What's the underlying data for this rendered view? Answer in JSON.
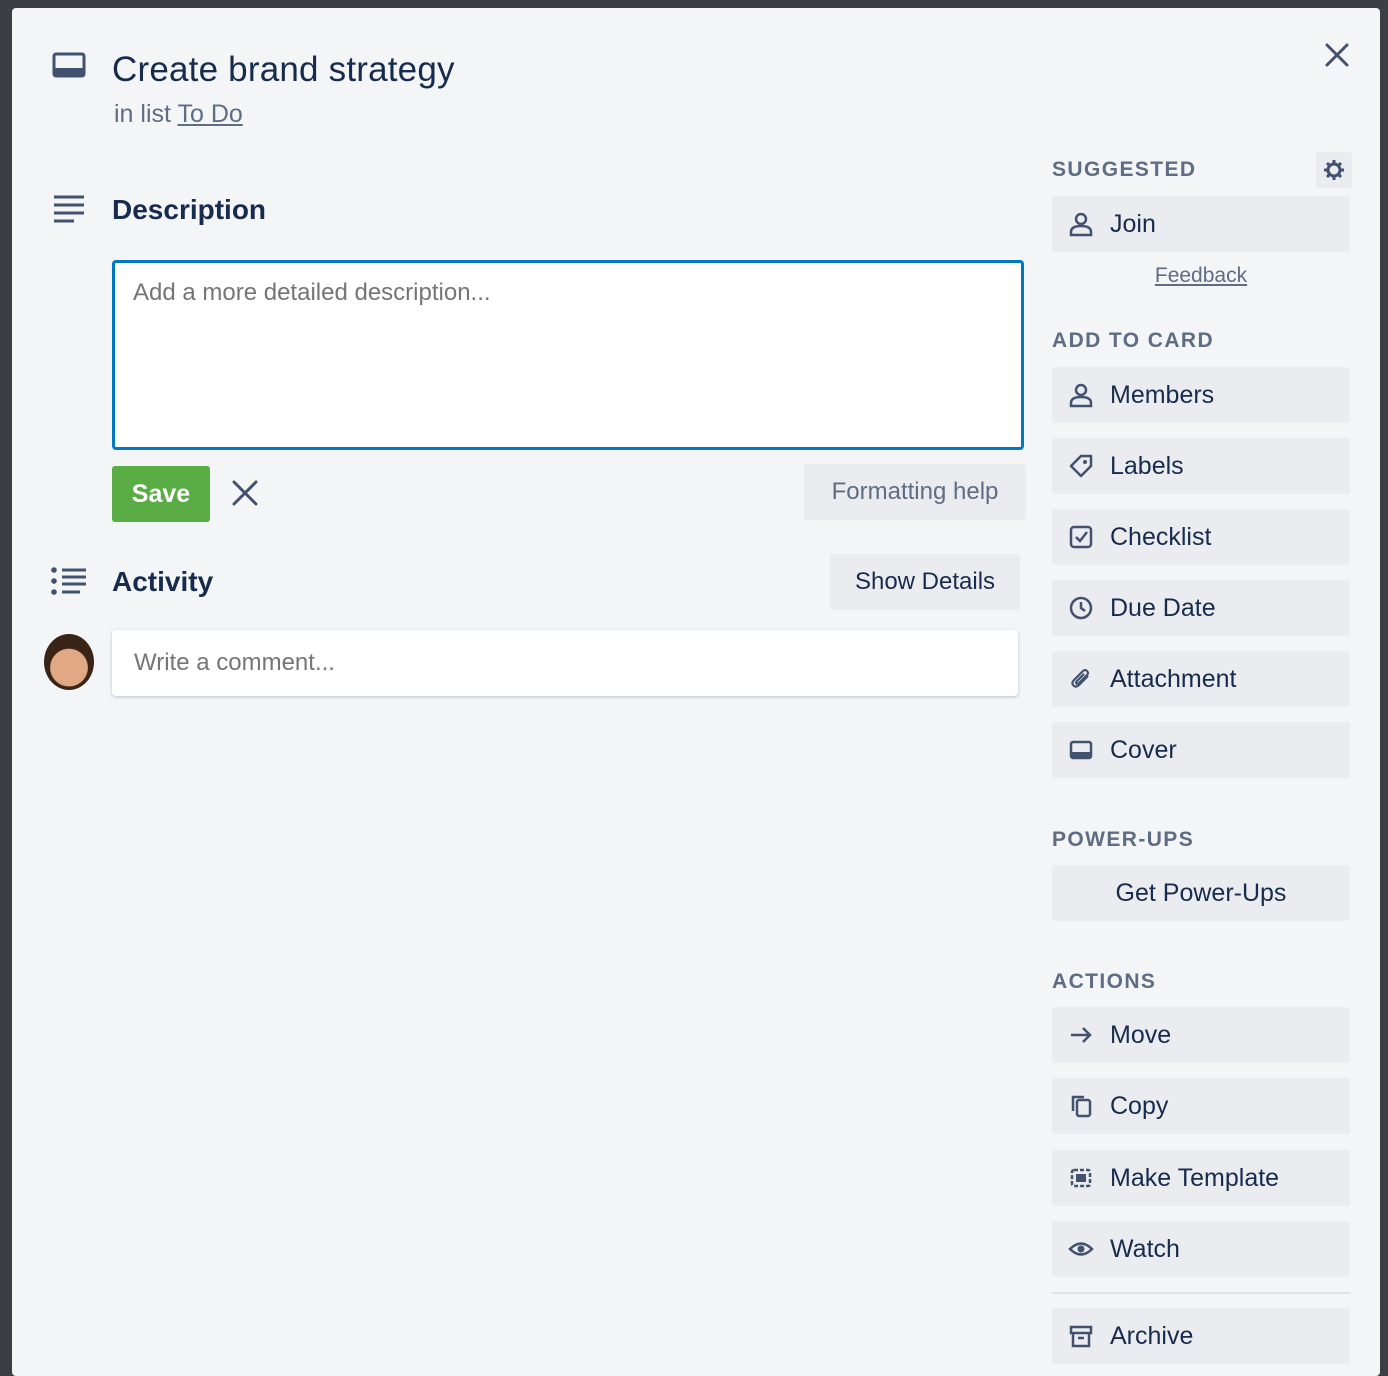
{
  "card": {
    "title": "Create brand strategy",
    "list_prefix": "in list",
    "list_name": "To Do"
  },
  "description": {
    "heading": "Description",
    "placeholder": "Add a more detailed description...",
    "save_label": "Save",
    "formatting_help_label": "Formatting help"
  },
  "activity": {
    "heading": "Activity",
    "show_details_label": "Show Details",
    "comment_placeholder": "Write a comment..."
  },
  "sidebar": {
    "suggested_heading": "SUGGESTED",
    "join_label": "Join",
    "feedback_label": "Feedback",
    "add_to_card_heading": "ADD TO CARD",
    "add_to_card": [
      {
        "label": "Members",
        "icon": "person-icon"
      },
      {
        "label": "Labels",
        "icon": "tag-icon"
      },
      {
        "label": "Checklist",
        "icon": "checkbox-icon"
      },
      {
        "label": "Due Date",
        "icon": "clock-icon"
      },
      {
        "label": "Attachment",
        "icon": "paperclip-icon"
      },
      {
        "label": "Cover",
        "icon": "cover-icon"
      }
    ],
    "power_ups_heading": "POWER-UPS",
    "get_power_ups_label": "Get Power-Ups",
    "actions_heading": "ACTIONS",
    "actions": [
      {
        "label": "Move",
        "icon": "arrow-right-icon"
      },
      {
        "label": "Copy",
        "icon": "copy-icon"
      },
      {
        "label": "Make Template",
        "icon": "template-icon"
      },
      {
        "label": "Watch",
        "icon": "eye-icon"
      },
      {
        "label": "Archive",
        "icon": "archive-icon"
      }
    ]
  },
  "colors": {
    "save_green": "#5aac44",
    "focus_blue": "#0079bf",
    "panel_bg": "#f4f5f7",
    "button_bg": "#ebecf0"
  }
}
